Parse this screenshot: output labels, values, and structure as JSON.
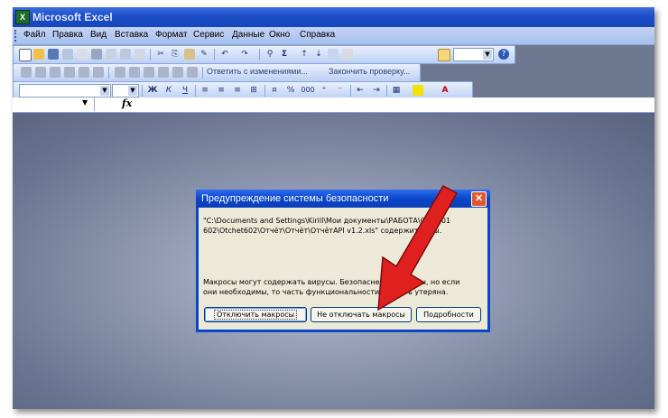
{
  "window": {
    "title": "Microsoft Excel",
    "app_icon": "excel-icon",
    "app_icon_text": "X"
  },
  "menubar": {
    "items": [
      "Файл",
      "Правка",
      "Вид",
      "Вставка",
      "Формат",
      "Сервис",
      "Данные",
      "Окно",
      "Справка"
    ]
  },
  "toolbar_standard": {
    "icons": [
      "new-document-icon",
      "open-icon",
      "save-icon",
      "permission-icon",
      "email-icon",
      "print-icon",
      "print-preview-icon",
      "spelling-icon",
      "research-icon",
      "cut-icon",
      "copy-icon",
      "paste-icon",
      "format-painter-icon",
      "undo-icon",
      "redo-icon",
      "hyperlink-icon",
      "autosum-icon",
      "sort-ascending-icon",
      "sort-descending-icon",
      "chart-wizard-icon",
      "drawing-icon",
      "zoom-dropdown",
      "help-icon"
    ],
    "zoom_value": ""
  },
  "toolbar_reviewing": {
    "reply_with_changes": "Ответить с изменениями...",
    "end_review": "Закончить проверку..."
  },
  "toolbar_formatting": {
    "font_name": "",
    "font_size": "",
    "bold": "Ж",
    "italic": "К",
    "underline": "Ч",
    "percent": "%",
    "thousands": "000"
  },
  "formula_bar": {
    "name_box": "",
    "fx": "fx",
    "content": ""
  },
  "dialog": {
    "title": "Предупреждение системы безопасности",
    "file_line1": "\"C:\\Documents and Settings\\Kirill\\Мои документы\\РАБОТА\\Отч 601",
    "file_line2": "602\\Otchet602\\Отчёт\\Отчёт\\ОтчётАРI v1.2.xls\" содержит      росы.",
    "warning_line1": "Макросы могут содержать вирусы. Безопаснее о         макросы, но если",
    "warning_line2": "они необходимы, то часть функциональности мо        быть утеряна.",
    "buttons": {
      "disable": "Отключить макросы",
      "enable": "Не отключать макросы",
      "details": "Подробности"
    }
  },
  "colors": {
    "titlebar": "#1f4fc9",
    "dialog_border": "#0a46c8",
    "dialog_bg": "#ece9d8",
    "arrow": "#e0201e",
    "workspace": "#8a93aa"
  }
}
